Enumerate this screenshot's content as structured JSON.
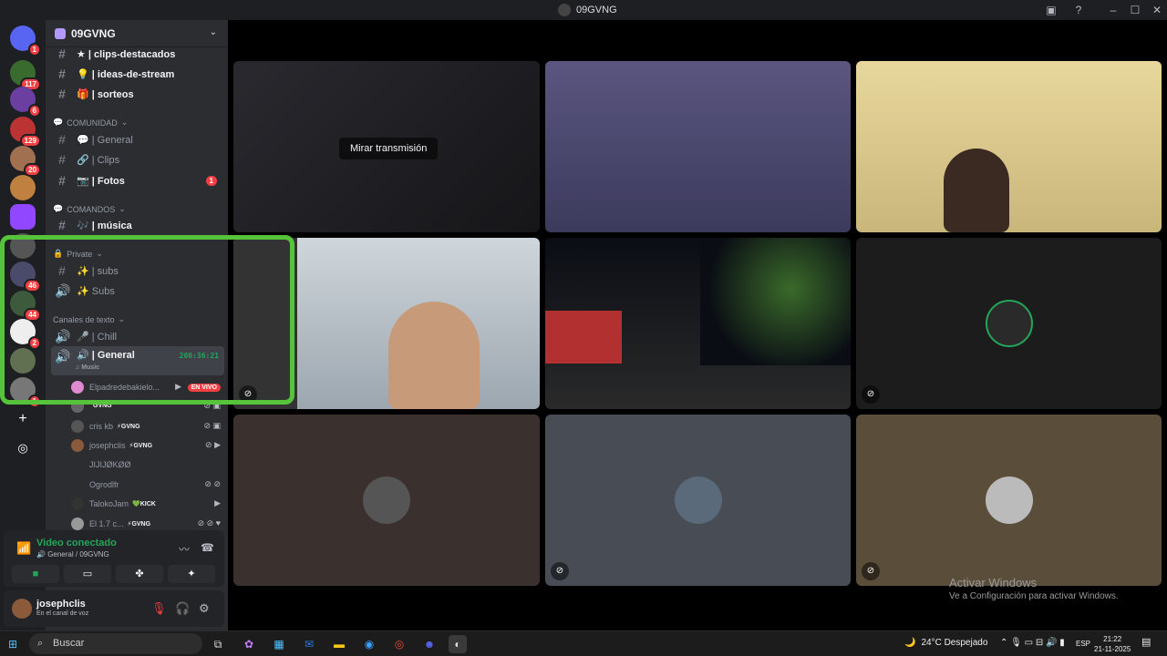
{
  "window": {
    "title": "09GVNG"
  },
  "servers": {
    "badges": [
      "1",
      "117",
      "6",
      "129",
      "20",
      "46",
      "44",
      "2",
      "1"
    ]
  },
  "guild": {
    "name": "09GVNG"
  },
  "channels": [
    {
      "label": "★ | clips-destacados",
      "icon": "#"
    },
    {
      "label": "💡 | ideas-de-stream",
      "icon": "#"
    },
    {
      "label": "🎁 | sorteos",
      "icon": "#"
    },
    {
      "label": "💬 | General",
      "icon": "#"
    },
    {
      "label": "🔗 | Clips",
      "icon": "#"
    },
    {
      "label": "📷 | Fotos",
      "icon": "#",
      "badge": "1"
    },
    {
      "label": "🎶 | música",
      "icon": "#"
    },
    {
      "label": "✨ | subs",
      "icon": "#"
    },
    {
      "label": "✨ Subs",
      "icon": "🔊"
    },
    {
      "label": "🎤 | Chill",
      "icon": "🔊"
    },
    {
      "label": "🔊 | General",
      "icon": "🔊"
    }
  ],
  "categories": {
    "comunidad": "COMUNIDAD",
    "comandos": "COMANDOS",
    "private": "Private",
    "texto": "Canales de texto"
  },
  "voice_channel": {
    "timer": "200:36:21",
    "activity": "Music"
  },
  "voice_users": [
    {
      "name": "Elpadredebakielo...",
      "tag": "",
      "live": "EN VIVO"
    },
    {
      "name": "",
      "tag": "GVNG",
      "live": ""
    },
    {
      "name": "cris kb",
      "tag": "⚡GVNG",
      "live": ""
    },
    {
      "name": "josephclis",
      "tag": "⚡GVNG",
      "live": ""
    },
    {
      "name": "JIJIJØKØØ",
      "tag": "",
      "live": ""
    },
    {
      "name": "Ogrodlfr",
      "tag": "",
      "live": ""
    },
    {
      "name": "TalokoJam",
      "tag": "💚KICK",
      "live": ""
    },
    {
      "name": "El 1.7 c...",
      "tag": "⚡GVNG",
      "live": ""
    }
  ],
  "voice_panel": {
    "status": "Video conectado",
    "location": "General / 09GVNG"
  },
  "user_panel": {
    "name": "josephclis",
    "status": "En el canal de voz"
  },
  "stage": {
    "watch_label": "Mirar transmisión"
  },
  "activation": {
    "line1": "Activar Windows",
    "line2": "Ve a Configuración para activar Windows."
  },
  "taskbar": {
    "search": "Buscar",
    "weather": "24°C  Despejado",
    "lang": "ESP",
    "time": "21:22",
    "date": "21-11-2025"
  }
}
